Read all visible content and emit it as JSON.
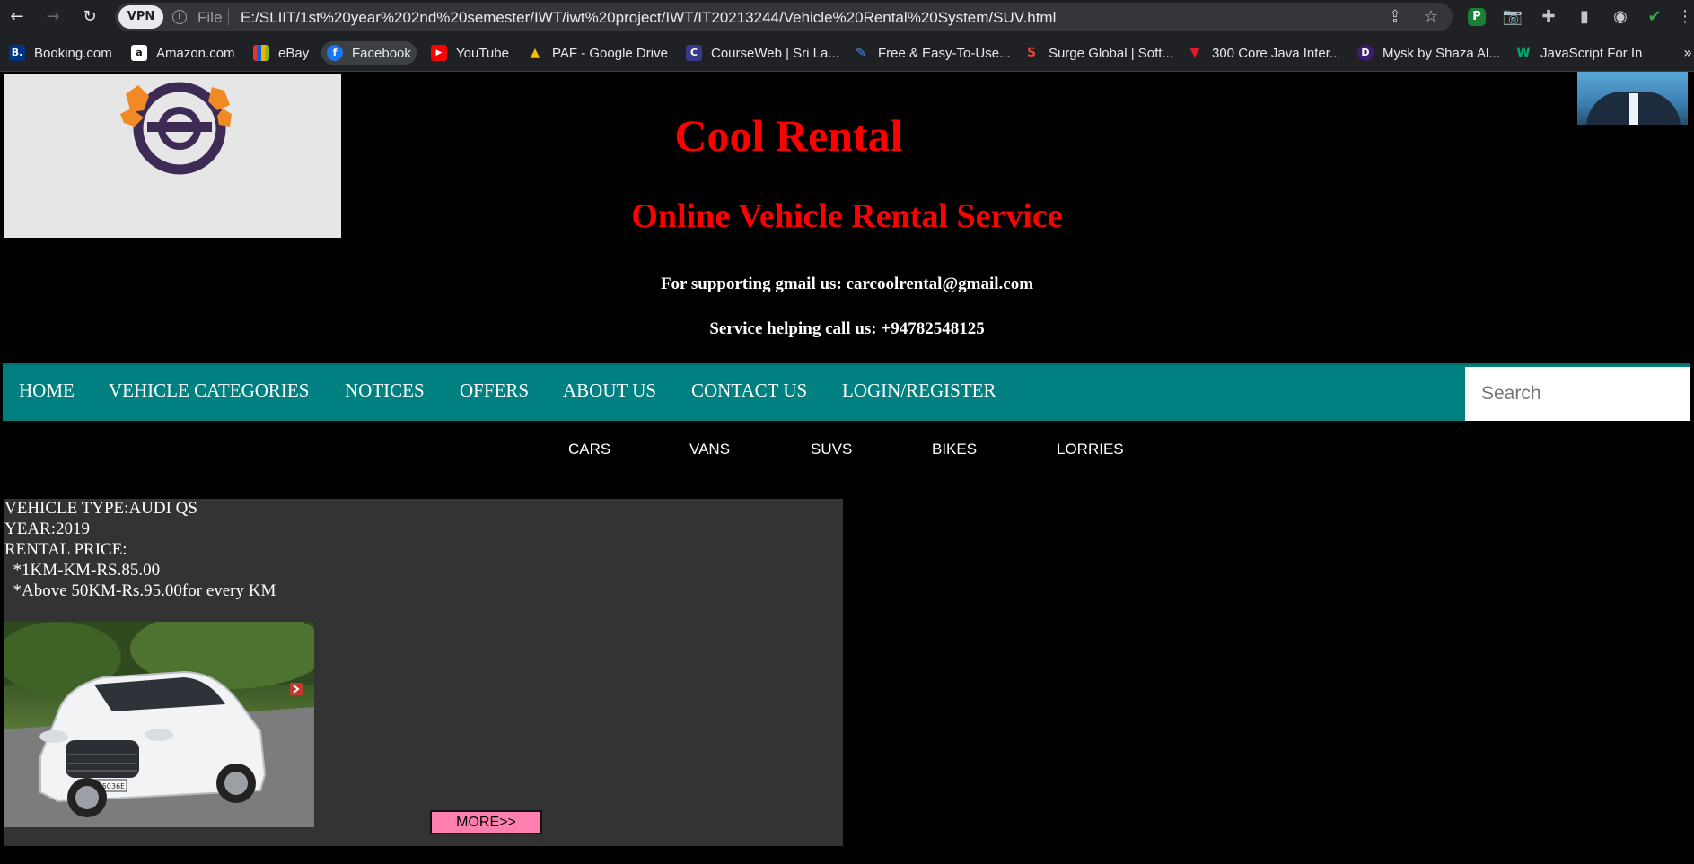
{
  "browser": {
    "vpn_label": "VPN",
    "file_label": "File",
    "url": "E:/SLIIT/1st%20year%202nd%20semester/IWT/iwt%20project/IWT/IT20213244/Vehicle%20Rental%20System/SUV.html",
    "extension_letter": "P",
    "bookmarks": [
      {
        "label": "Booking.com",
        "icon": "booking-icon",
        "badge": "B."
      },
      {
        "label": "Amazon.com",
        "icon": "amazon-icon",
        "badge": "a"
      },
      {
        "label": "eBay",
        "icon": "ebay-icon",
        "badge": ""
      },
      {
        "label": "Facebook",
        "icon": "facebook-icon",
        "badge": "f"
      },
      {
        "label": "YouTube",
        "icon": "youtube-icon",
        "badge": "▶"
      },
      {
        "label": "PAF - Google Drive",
        "icon": "google-drive-icon",
        "badge": "▲"
      },
      {
        "label": "CourseWeb | Sri La...",
        "icon": "courseweb-icon",
        "badge": "C"
      },
      {
        "label": "Free & Easy-To-Use...",
        "icon": "free-easy-icon",
        "badge": "✎"
      },
      {
        "label": "Surge Global | Soft...",
        "icon": "surge-global-icon",
        "badge": "S"
      },
      {
        "label": "300 Core Java Inter...",
        "icon": "java-icon",
        "badge": "▼"
      },
      {
        "label": "Mysk by Shaza Al...",
        "icon": "mysk-icon",
        "badge": "D"
      },
      {
        "label": "JavaScript For In",
        "icon": "javascript-icon",
        "badge": "W"
      }
    ],
    "more_bookmarks": "»"
  },
  "site": {
    "title": "Cool Rental",
    "subtitle": "Online Vehicle Rental Service",
    "gmail_line": "For supporting gmail us: carcoolrental@gmail.com",
    "phone_line": "Service helping call us: +94782548125"
  },
  "nav": {
    "items": [
      "HOME",
      "VEHICLE CATEGORIES",
      "NOTICES",
      "OFFERS",
      "ABOUT US",
      "CONTACT US",
      "LOGIN/REGISTER"
    ],
    "search_placeholder": "Search"
  },
  "subnav": {
    "items": [
      "CARS",
      "VANS",
      "SUVS",
      "BIKES",
      "LORRIES"
    ]
  },
  "vehicle": {
    "type": "VEHICLE TYPE:AUDI QS",
    "year": "YEAR:2019",
    "price_label": "RENTAL PRICE:",
    "price_1": "  *1KM-KM-RS.85.00",
    "price_2": "  *Above 50KM-Rs.95.00for every KM",
    "plate": "IN · Q 5036E",
    "more_button": "MORE>>"
  },
  "colors": {
    "page_bg": "#000000",
    "title_red": "#ff0000",
    "nav_teal": "#008080",
    "card_bg": "#333333",
    "more_button_pink": "#ff80b0",
    "logo_purple": "#3d2b56",
    "logo_orange": "#f08a24"
  }
}
